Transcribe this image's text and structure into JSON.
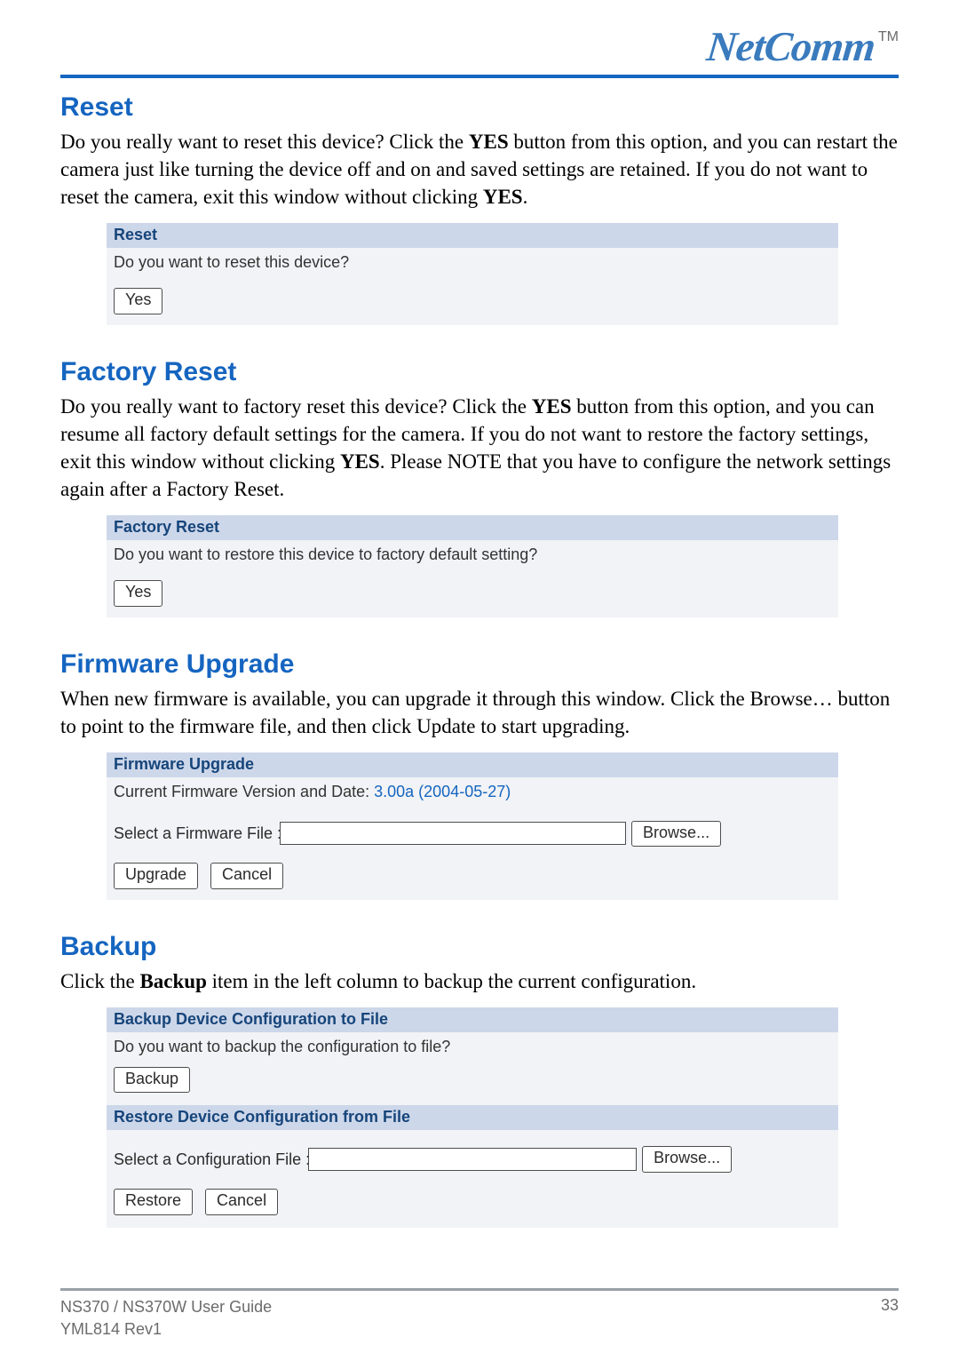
{
  "brand": {
    "name": "NetComm",
    "tm": "TM"
  },
  "sections": {
    "reset": {
      "heading": "Reset",
      "para_a": "Do you really want to reset this device?  Click the ",
      "para_b": "YES",
      "para_c": " button from this option, and you can restart the camera just like turning the device off and on and saved settings are retained.  If you do not want to reset the camera, exit this window without clicking ",
      "para_d": "YES",
      "para_e": ".",
      "panel_title": "Reset",
      "panel_text": "Do you want to reset this device?",
      "yes_label": "Yes"
    },
    "factory": {
      "heading": "Factory Reset",
      "para_a": "Do you really want to factory reset this device?  Click the ",
      "para_b": "YES",
      "para_c": " button from this option, and you can resume all factory default settings for the camera.  If you do not want to restore the factory settings, exit this window without clicking ",
      "para_d": "YES",
      "para_e": ".  Please NOTE that you have to configure the network settings again after a Factory Reset.",
      "panel_title": "Factory Reset",
      "panel_text": "Do you want to restore this device to factory default setting?",
      "yes_label": "Yes"
    },
    "firmware": {
      "heading": "Firmware Upgrade",
      "para": "When new firmware is available, you can upgrade it through this window.  Click the Browse… button to point to the firmware file, and then click Update to start upgrading.",
      "panel_title": "Firmware Upgrade",
      "current_label": "Current Firmware Version and Date: ",
      "current_value": "3.00a (2004-05-27)",
      "file_label": "Select a Firmware File :",
      "browse_label": "Browse...",
      "upgrade_label": "Upgrade",
      "cancel_label": "Cancel"
    },
    "backup": {
      "heading": "Backup",
      "para_a": "Click the ",
      "para_b": "Backup",
      "para_c": " item in the left column to backup the current configuration.",
      "panel_title_backup": "Backup Device Configuration to File",
      "backup_text": "Do you want to backup the configuration to file?",
      "backup_btn": "Backup",
      "panel_title_restore": "Restore Device Configuration from File",
      "file_label": "Select a Configuration File :",
      "browse_label": "Browse...",
      "restore_btn": "Restore",
      "cancel_btn": "Cancel"
    }
  },
  "footer": {
    "line1": "NS370 / NS370W User Guide",
    "line2": "YML814 Rev1",
    "page": "33"
  }
}
